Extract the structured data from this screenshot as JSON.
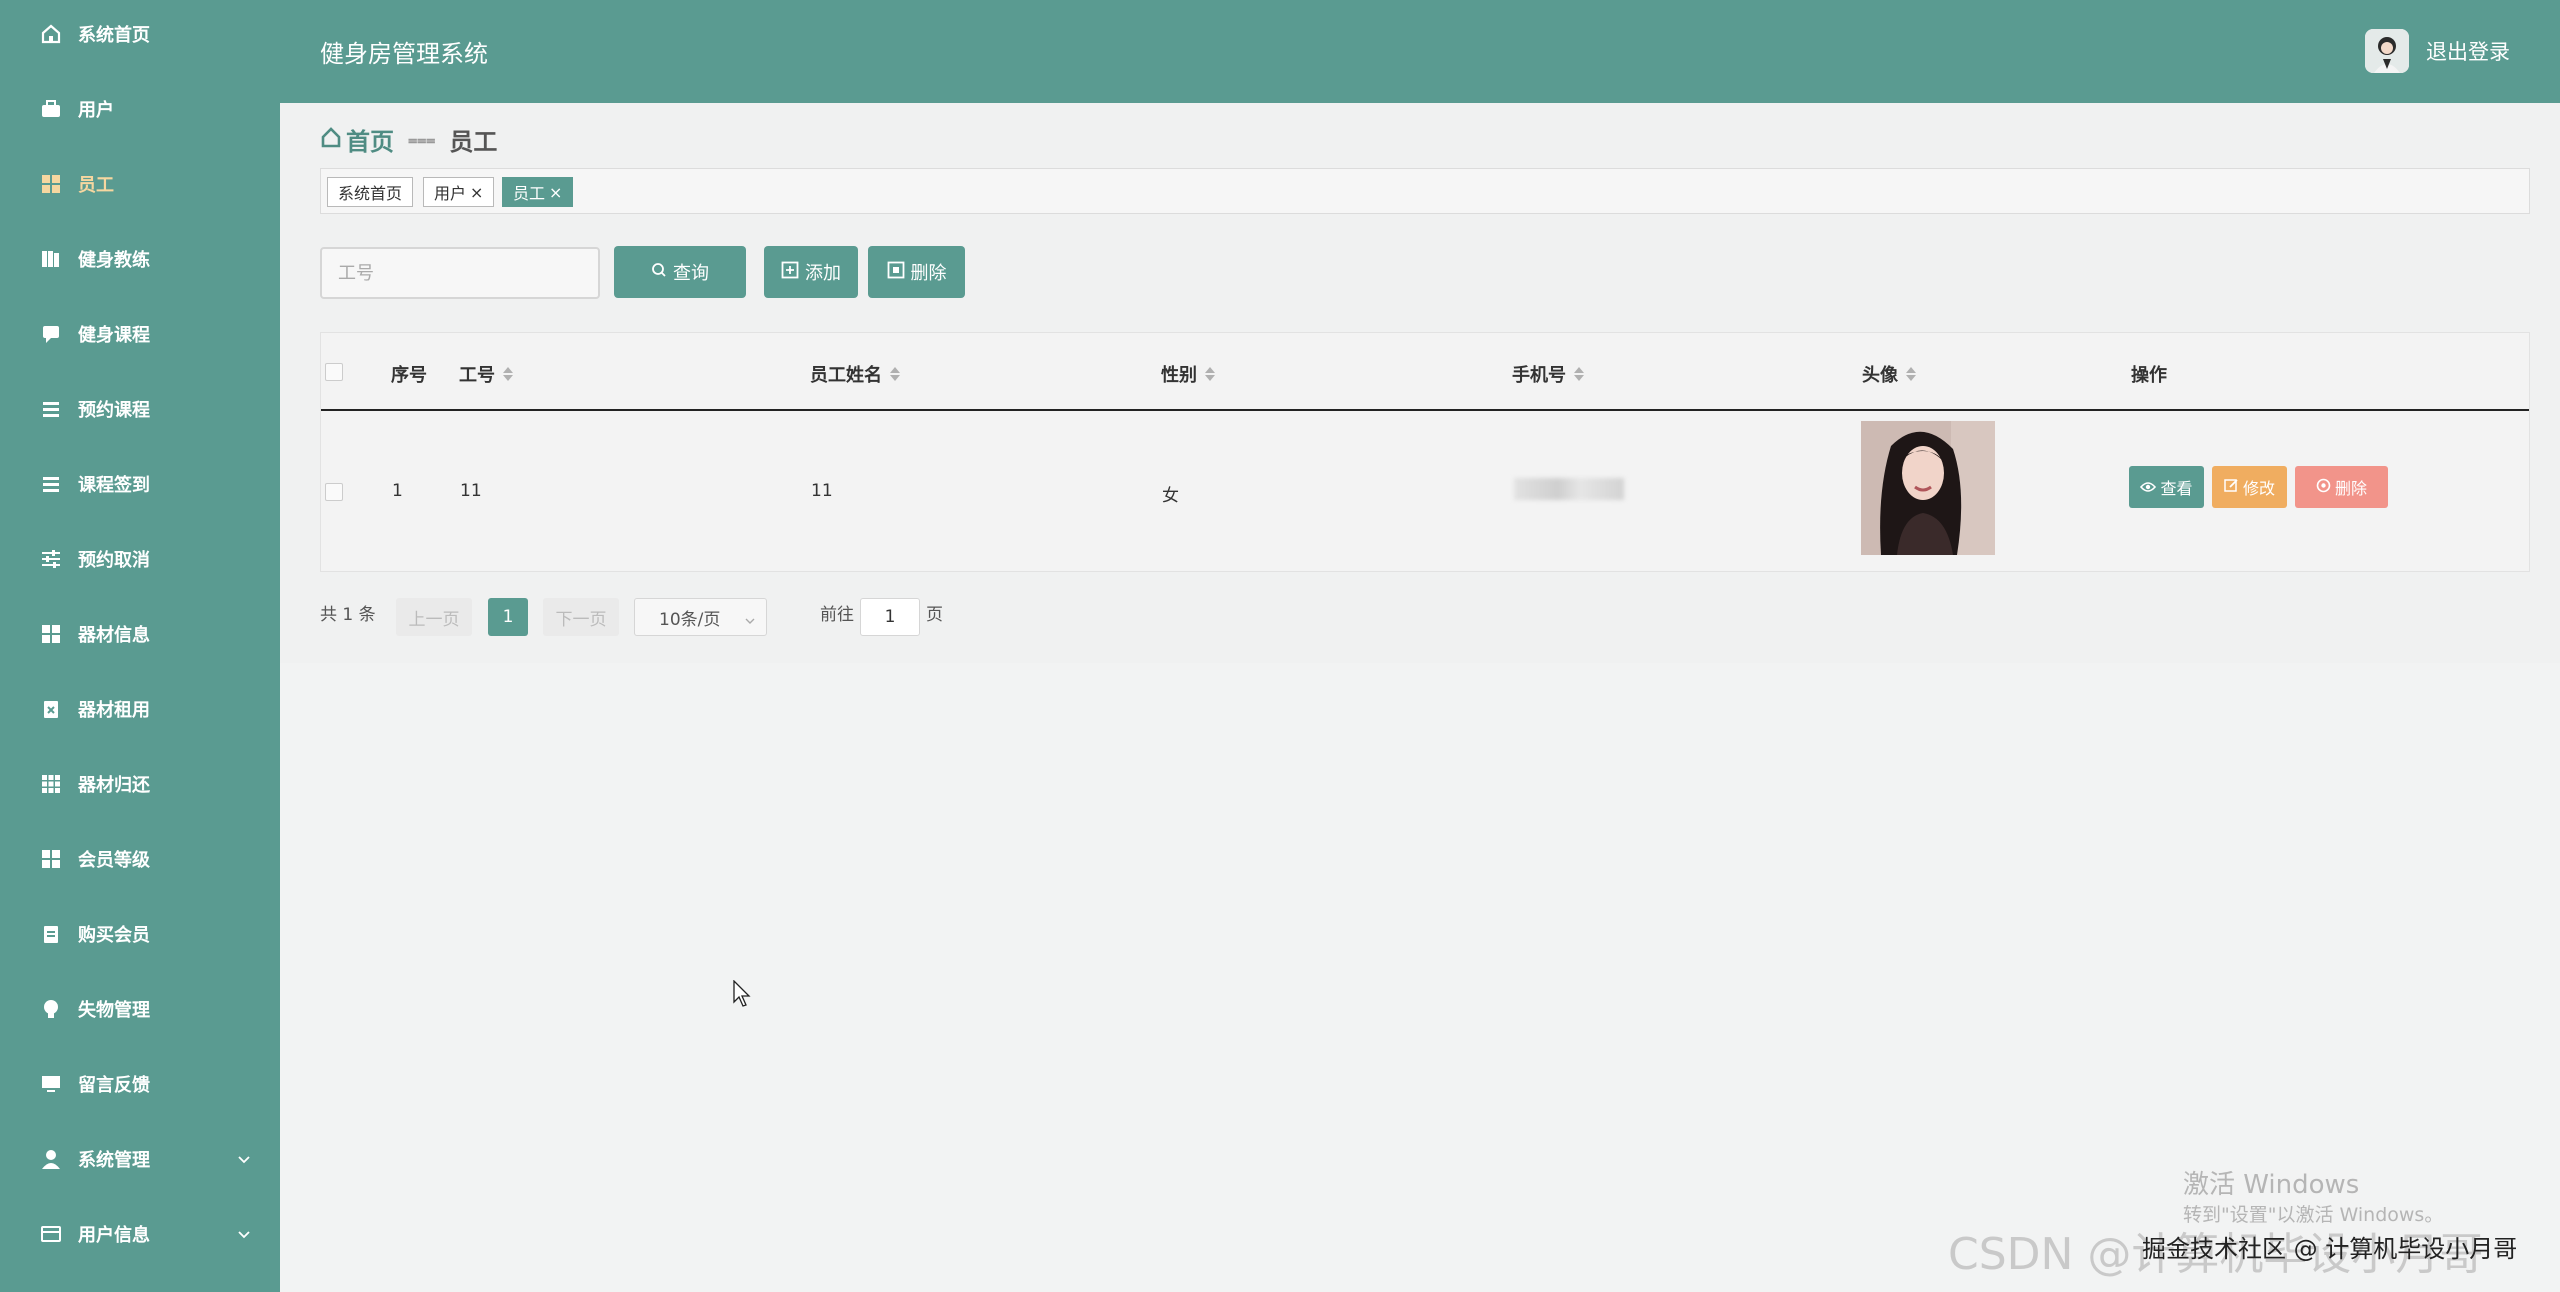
{
  "sidebar": {
    "items": [
      {
        "label": "系统首页",
        "icon": "home-icon"
      },
      {
        "label": "用户",
        "icon": "briefcase-icon"
      },
      {
        "label": "员工",
        "icon": "grid-icon"
      },
      {
        "label": "健身教练",
        "icon": "book-icon"
      },
      {
        "label": "健身课程",
        "icon": "chat-icon"
      },
      {
        "label": "预约课程",
        "icon": "list-icon"
      },
      {
        "label": "课程签到",
        "icon": "list-icon"
      },
      {
        "label": "预约取消",
        "icon": "sliders-icon"
      },
      {
        "label": "器材信息",
        "icon": "grid-icon"
      },
      {
        "label": "器材租用",
        "icon": "clipboard-x-icon"
      },
      {
        "label": "器材归还",
        "icon": "table-icon"
      },
      {
        "label": "会员等级",
        "icon": "grid-icon"
      },
      {
        "label": "购买会员",
        "icon": "clipboard-icon"
      },
      {
        "label": "失物管理",
        "icon": "bulb-icon"
      },
      {
        "label": "留言反馈",
        "icon": "monitor-icon"
      },
      {
        "label": "系统管理",
        "icon": "user-icon"
      },
      {
        "label": "用户信息",
        "icon": "card-icon"
      }
    ],
    "active_index": 2
  },
  "header": {
    "title": "健身房管理系统",
    "logout": "退出登录"
  },
  "breadcrumb": {
    "home": "首页",
    "sep": "⩶",
    "current": "员工"
  },
  "tags": [
    {
      "label": "系统首页",
      "closable": false
    },
    {
      "label": "用户",
      "closable": true
    },
    {
      "label": "员工",
      "closable": true,
      "active": true
    }
  ],
  "tag_close": "×",
  "search": {
    "placeholder": "工号",
    "query_label": "查询",
    "add_label": "添加",
    "delete_label": "删除"
  },
  "table": {
    "columns": [
      "序号",
      "工号",
      "员工姓名",
      "性别",
      "手机号",
      "头像",
      "操作"
    ],
    "rows": [
      {
        "index": "1",
        "job_no": "11",
        "name": "11",
        "gender": "女"
      }
    ],
    "actions": {
      "view": "查看",
      "edit": "修改",
      "delete": "删除"
    }
  },
  "pagination": {
    "total": "共 1 条",
    "prev": "上一页",
    "current_page": "1",
    "next": "下一页",
    "page_size": "10条/页",
    "goto_label": "前往",
    "goto_value": "1",
    "page_suffix": "页"
  },
  "watermark": {
    "activate_title": "激活 Windows",
    "activate_sub": "转到\"设置\"以激活 Windows。",
    "csdn": "CSDN @计算机毕设小月哥",
    "juejin": "掘金技术社区 @ 计算机毕设小月哥"
  },
  "colors": {
    "primary": "#5a9b91",
    "edit": "#f0ad60",
    "delete": "#f2948a"
  }
}
